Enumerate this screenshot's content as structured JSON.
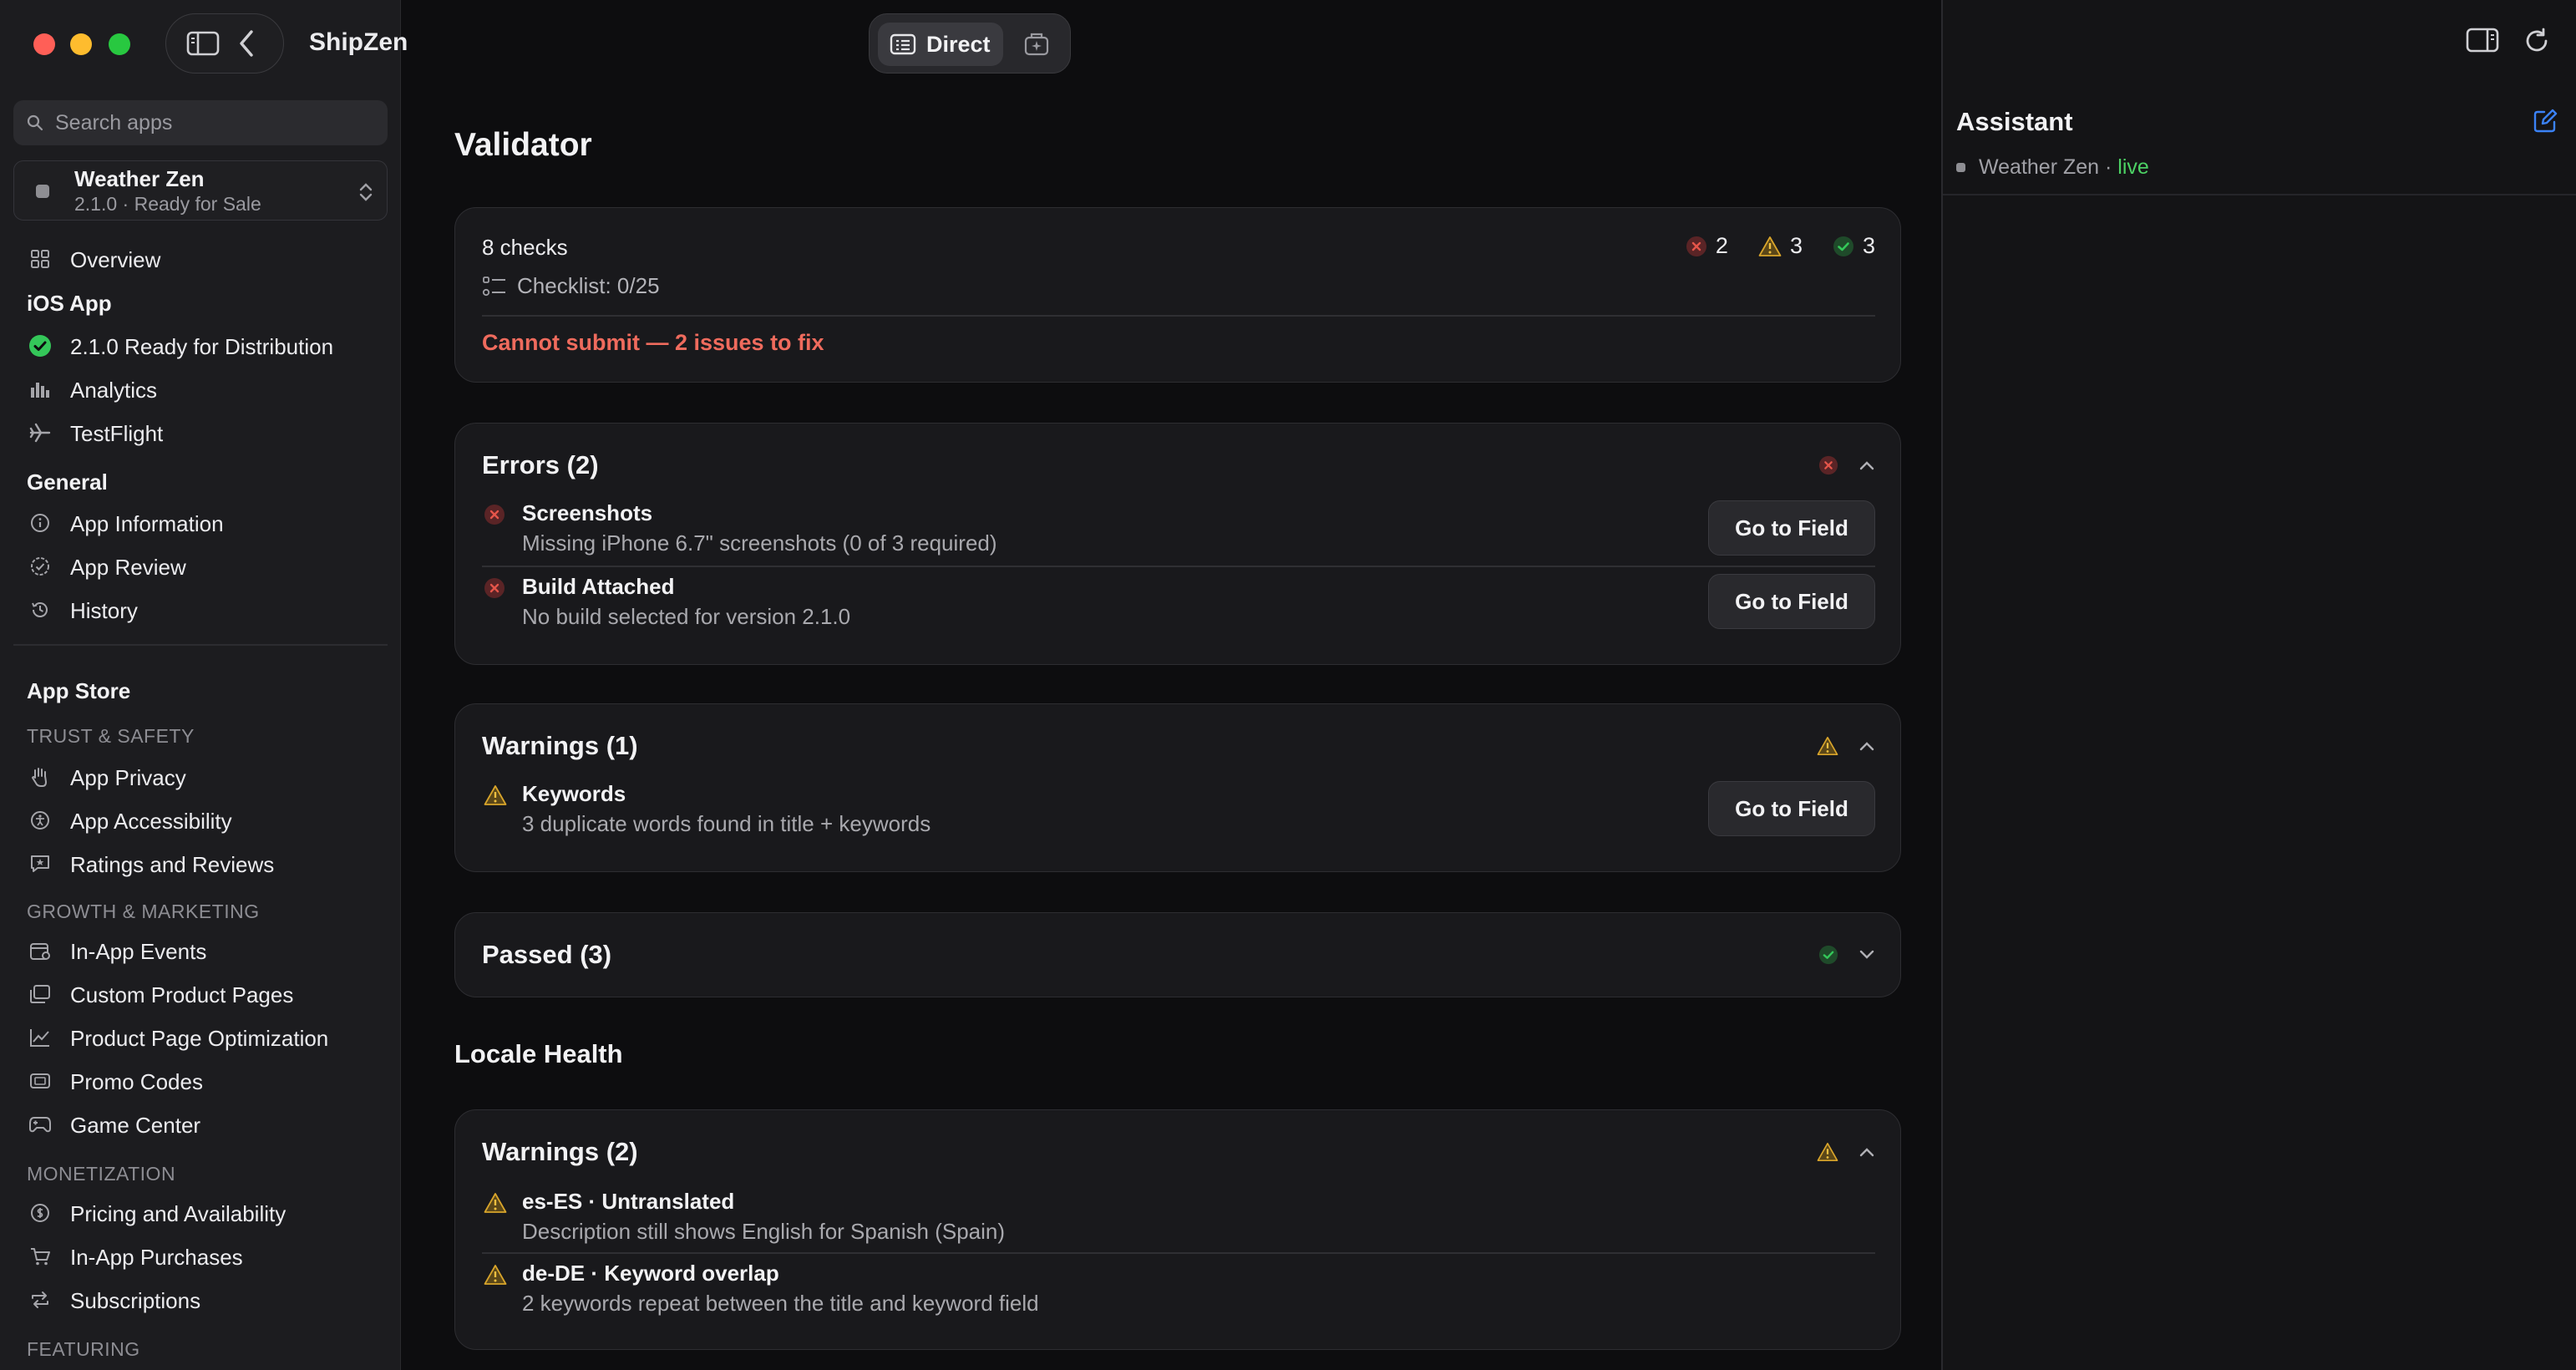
{
  "app": {
    "title": "ShipZen"
  },
  "search": {
    "placeholder": "Search apps"
  },
  "app_picker": {
    "name": "Weather Zen",
    "subtitle": "2.1.0 · Ready for Sale"
  },
  "toolbar": {
    "mode_direct": "Direct"
  },
  "sidebar": {
    "overview": "Overview",
    "ios_header": "iOS App",
    "ios_items": [
      {
        "label": "2.1.0 Ready for Distribution",
        "icon": "status-ready-icon"
      },
      {
        "label": "Analytics",
        "icon": "bar-chart-icon"
      },
      {
        "label": "TestFlight",
        "icon": "airplane-icon"
      }
    ],
    "general_header": "General",
    "general_items": [
      {
        "label": "App Information",
        "icon": "info-icon"
      },
      {
        "label": "App Review",
        "icon": "review-badge-icon"
      },
      {
        "label": "History",
        "icon": "history-icon"
      }
    ],
    "store_header": "App Store",
    "trust_header": "TRUST & SAFETY",
    "trust_items": [
      {
        "label": "App Privacy",
        "icon": "hand-icon"
      },
      {
        "label": "App Accessibility",
        "icon": "accessibility-icon"
      },
      {
        "label": "Ratings and Reviews",
        "icon": "star-bubble-icon"
      }
    ],
    "growth_header": "GROWTH & MARKETING",
    "growth_items": [
      {
        "label": "In-App Events",
        "icon": "calendar-icon"
      },
      {
        "label": "Custom Product Pages",
        "icon": "pages-icon"
      },
      {
        "label": "Product Page Optimization",
        "icon": "trend-icon"
      },
      {
        "label": "Promo Codes",
        "icon": "ticket-icon"
      },
      {
        "label": "Game Center",
        "icon": "gamepad-icon"
      }
    ],
    "monetization_header": "MONETIZATION",
    "monetization_items": [
      {
        "label": "Pricing and Availability",
        "icon": "dollar-icon"
      },
      {
        "label": "In-App Purchases",
        "icon": "cart-icon"
      },
      {
        "label": "Subscriptions",
        "icon": "repeat-icon"
      }
    ],
    "featuring_header": "FEATURING"
  },
  "validator": {
    "title": "Validator",
    "summary": {
      "checks": "8 checks",
      "checklist": "Checklist: 0/25",
      "error_count": "2",
      "warning_count": "3",
      "passed_count": "3",
      "status": "Cannot submit — 2 issues to fix"
    },
    "errors": {
      "title": "Errors (2)",
      "items": [
        {
          "title": "Screenshots",
          "desc": "Missing iPhone 6.7\" screenshots (0 of 3 required)",
          "action": "Go to Field"
        },
        {
          "title": "Build Attached",
          "desc": "No build selected for version 2.1.0",
          "action": "Go to Field"
        }
      ]
    },
    "warnings": {
      "title": "Warnings (1)",
      "items": [
        {
          "title": "Keywords",
          "desc": "3 duplicate words found in title + keywords",
          "action": "Go to Field"
        }
      ]
    },
    "passed": {
      "title": "Passed (3)"
    }
  },
  "locale_health": {
    "title": "Locale Health",
    "warnings": {
      "title": "Warnings (2)",
      "items": [
        {
          "title": "es-ES · Untranslated",
          "desc": "Description still shows English for Spanish (Spain)"
        },
        {
          "title": "de-DE · Keyword overlap",
          "desc": "2 keywords repeat between the title and keyword field"
        }
      ]
    }
  },
  "assistant": {
    "title": "Assistant",
    "context_app": "Weather Zen",
    "context_sep": " · ",
    "status": "live"
  },
  "colors": {
    "error": "#e5554a",
    "warning": "#d9a52b",
    "success": "#34c759",
    "live": "#4cd164",
    "accent": "#3b82f6"
  }
}
